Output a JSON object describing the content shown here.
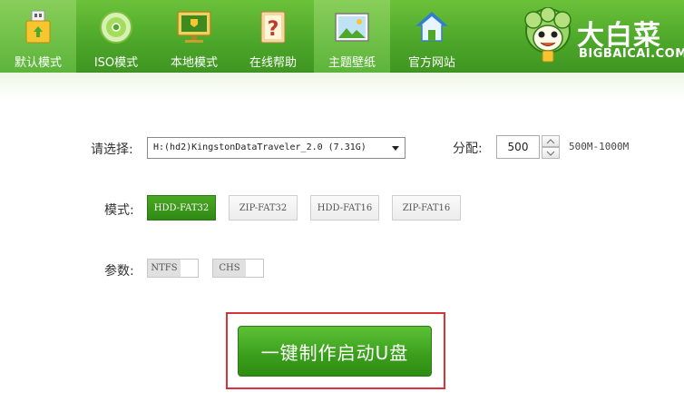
{
  "toolbar": {
    "tabs": [
      {
        "label": "默认模式",
        "icon": "usb-drive-icon"
      },
      {
        "label": "ISO模式",
        "icon": "disc-icon"
      },
      {
        "label": "本地模式",
        "icon": "monitor-icon"
      },
      {
        "label": "在线帮助",
        "icon": "help-icon"
      },
      {
        "label": "主题壁纸",
        "icon": "picture-icon"
      },
      {
        "label": "官方网站",
        "icon": "home-icon"
      }
    ],
    "active_tab": "默认模式"
  },
  "logo": {
    "cn": "大白菜",
    "en": "BIGBAICAI.COM"
  },
  "form": {
    "select_label": "请选择:",
    "select_value": "H:(hd2)KingstonDataTraveler_2.0 (7.31G)",
    "partition_label": "分配:",
    "partition_value": "500",
    "partition_range": "500M-1000M",
    "mode_label": "模式:",
    "modes": [
      "HDD-FAT32",
      "ZIP-FAT32",
      "HDD-FAT16",
      "ZIP-FAT16"
    ],
    "active_mode": "HDD-FAT32",
    "params_label": "参数:",
    "params": [
      "NTFS",
      "CHS"
    ]
  },
  "action": {
    "make_button": "一键制作启动U盘"
  },
  "colors": {
    "toolbar_green": "#4ea82a",
    "button_green": "#3a9e1c",
    "highlight_red": "#d9333a"
  }
}
